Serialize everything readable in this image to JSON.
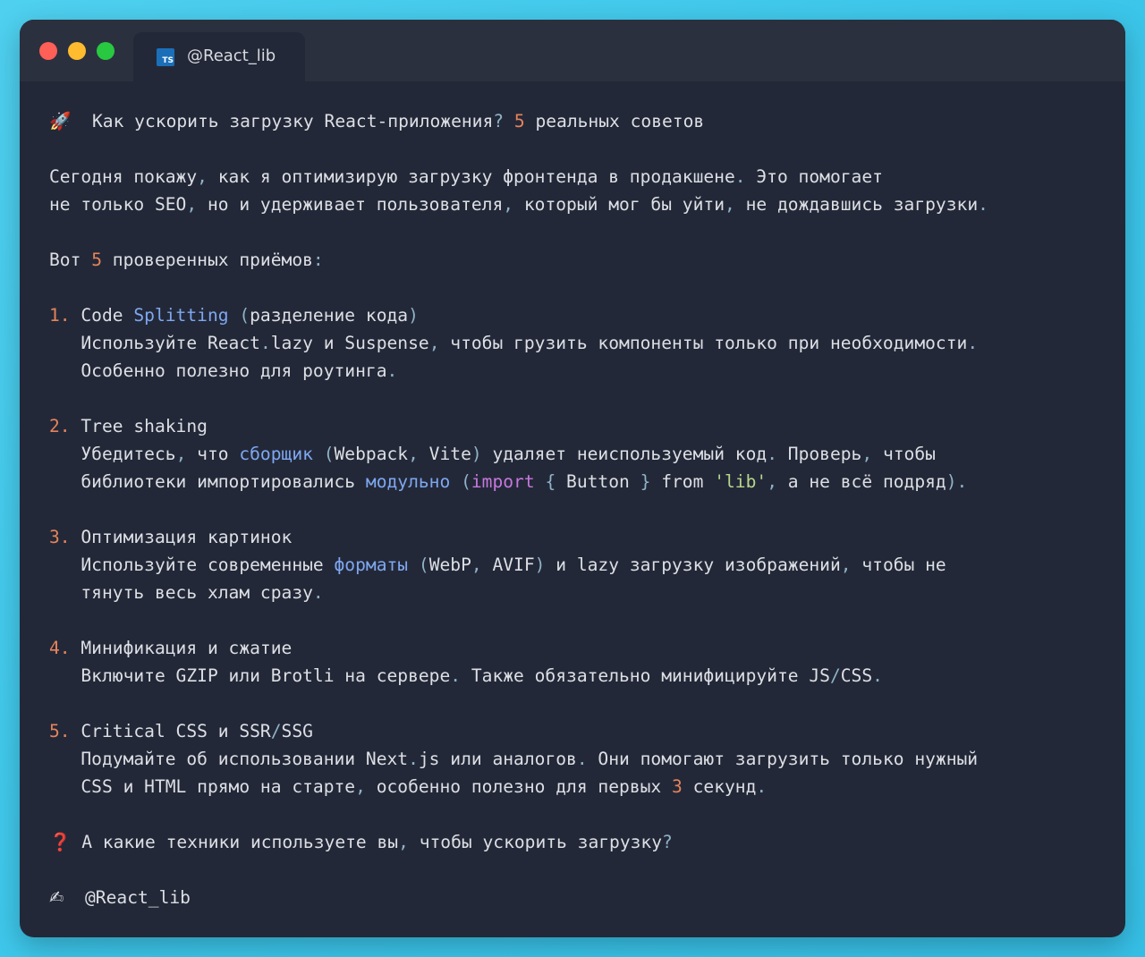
{
  "window": {
    "tab_title": "@React_lib",
    "tab_icon": "typescript-file-icon",
    "tab_icon_text": "TS"
  },
  "colors": {
    "text": "#dcdfe4",
    "number": "#e5845a",
    "keyword_blue": "#7ea8f0",
    "keyword_purple": "#c678dd",
    "string_green": "#b7d68a",
    "punctuation": "#8fb3c7",
    "question_red": "#f0454a"
  },
  "lines": [
    {
      "tokens": [
        {
          "t": "🚀",
          "c": "emoji"
        },
        {
          "t": "  Как ускорить загрузку React-приложения"
        },
        {
          "t": "?",
          "c": "hl-punct"
        },
        {
          "t": " "
        },
        {
          "t": "5",
          "c": "hl-orange"
        },
        {
          "t": " реальных советов"
        }
      ]
    },
    {
      "gap": true
    },
    {
      "tokens": [
        {
          "t": "Сегодня покажу"
        },
        {
          "t": ",",
          "c": "hl-punct"
        },
        {
          "t": " как я оптимизирую загрузку фронтенда в продакшене"
        },
        {
          "t": ".",
          "c": "hl-punct"
        },
        {
          "t": " Это помогает"
        }
      ]
    },
    {
      "tokens": [
        {
          "t": "не только SEO"
        },
        {
          "t": ",",
          "c": "hl-punct"
        },
        {
          "t": " но и удерживает пользователя"
        },
        {
          "t": ",",
          "c": "hl-punct"
        },
        {
          "t": " который мог бы уйти"
        },
        {
          "t": ",",
          "c": "hl-punct"
        },
        {
          "t": " не дождавшись загрузки"
        },
        {
          "t": ".",
          "c": "hl-punct"
        }
      ]
    },
    {
      "gap": true
    },
    {
      "tokens": [
        {
          "t": "Вот "
        },
        {
          "t": "5",
          "c": "hl-orange"
        },
        {
          "t": " проверенных приёмов"
        },
        {
          "t": ":",
          "c": "hl-punct"
        }
      ]
    },
    {
      "gap": true
    },
    {
      "tokens": [
        {
          "t": "1.",
          "c": "hl-orange"
        },
        {
          "t": " Code "
        },
        {
          "t": "Splitting",
          "c": "hl-blue"
        },
        {
          "t": " "
        },
        {
          "t": "(",
          "c": "hl-punct"
        },
        {
          "t": "разделение кода"
        },
        {
          "t": ")",
          "c": "hl-punct"
        }
      ]
    },
    {
      "tokens": [
        {
          "t": "   Используйте React"
        },
        {
          "t": ".",
          "c": "hl-punct"
        },
        {
          "t": "lazy и Suspense"
        },
        {
          "t": ",",
          "c": "hl-punct"
        },
        {
          "t": " чтобы грузить компоненты только при необходимости"
        },
        {
          "t": ".",
          "c": "hl-punct"
        }
      ]
    },
    {
      "tokens": [
        {
          "t": "   Особенно полезно для роутинга"
        },
        {
          "t": ".",
          "c": "hl-punct"
        }
      ]
    },
    {
      "gap": true
    },
    {
      "tokens": [
        {
          "t": "2.",
          "c": "hl-orange"
        },
        {
          "t": " Tree shaking"
        }
      ]
    },
    {
      "tokens": [
        {
          "t": "   Убедитесь"
        },
        {
          "t": ",",
          "c": "hl-punct"
        },
        {
          "t": " что "
        },
        {
          "t": "сборщик",
          "c": "hl-blue"
        },
        {
          "t": " "
        },
        {
          "t": "(",
          "c": "hl-punct"
        },
        {
          "t": "Webpack"
        },
        {
          "t": ",",
          "c": "hl-punct"
        },
        {
          "t": " Vite"
        },
        {
          "t": ")",
          "c": "hl-punct"
        },
        {
          "t": " удаляет неиспользуемый код"
        },
        {
          "t": ".",
          "c": "hl-punct"
        },
        {
          "t": " Проверь"
        },
        {
          "t": ",",
          "c": "hl-punct"
        },
        {
          "t": " чтобы"
        }
      ]
    },
    {
      "tokens": [
        {
          "t": "   библиотеки импортировались "
        },
        {
          "t": "модульно",
          "c": "hl-blue"
        },
        {
          "t": " "
        },
        {
          "t": "(",
          "c": "hl-punct"
        },
        {
          "t": "import",
          "c": "hl-purple"
        },
        {
          "t": " "
        },
        {
          "t": "{",
          "c": "hl-punct"
        },
        {
          "t": " Button "
        },
        {
          "t": "}",
          "c": "hl-punct"
        },
        {
          "t": " from "
        },
        {
          "t": "'lib'",
          "c": "hl-green"
        },
        {
          "t": ",",
          "c": "hl-punct"
        },
        {
          "t": " а не всё подряд"
        },
        {
          "t": ").",
          "c": "hl-punct"
        }
      ]
    },
    {
      "gap": true
    },
    {
      "tokens": [
        {
          "t": "3.",
          "c": "hl-orange"
        },
        {
          "t": " Оптимизация картинок"
        }
      ]
    },
    {
      "tokens": [
        {
          "t": "   Используйте современные "
        },
        {
          "t": "форматы",
          "c": "hl-blue"
        },
        {
          "t": " "
        },
        {
          "t": "(",
          "c": "hl-punct"
        },
        {
          "t": "WebP"
        },
        {
          "t": ",",
          "c": "hl-punct"
        },
        {
          "t": " AVIF"
        },
        {
          "t": ")",
          "c": "hl-punct"
        },
        {
          "t": " и lazy загрузку изображений"
        },
        {
          "t": ",",
          "c": "hl-punct"
        },
        {
          "t": " чтобы не"
        }
      ]
    },
    {
      "tokens": [
        {
          "t": "   тянуть весь хлам сразу"
        },
        {
          "t": ".",
          "c": "hl-punct"
        }
      ]
    },
    {
      "gap": true
    },
    {
      "tokens": [
        {
          "t": "4.",
          "c": "hl-orange"
        },
        {
          "t": " Минификация и сжатие"
        }
      ]
    },
    {
      "tokens": [
        {
          "t": "   Включите GZIP или Brotli на сервере"
        },
        {
          "t": ".",
          "c": "hl-punct"
        },
        {
          "t": " Также обязательно минифицируйте JS"
        },
        {
          "t": "/",
          "c": "hl-punct"
        },
        {
          "t": "CSS"
        },
        {
          "t": ".",
          "c": "hl-punct"
        }
      ]
    },
    {
      "gap": true
    },
    {
      "tokens": [
        {
          "t": "5.",
          "c": "hl-orange"
        },
        {
          "t": " Critical CSS и SSR"
        },
        {
          "t": "/",
          "c": "hl-punct"
        },
        {
          "t": "SSG"
        }
      ]
    },
    {
      "tokens": [
        {
          "t": "   Подумайте об использовании Next"
        },
        {
          "t": ".",
          "c": "hl-punct"
        },
        {
          "t": "js или аналогов"
        },
        {
          "t": ".",
          "c": "hl-punct"
        },
        {
          "t": " Они помогают загрузить только нужный"
        }
      ]
    },
    {
      "tokens": [
        {
          "t": "   CSS и HTML прямо на старте"
        },
        {
          "t": ",",
          "c": "hl-punct"
        },
        {
          "t": " особенно полезно для первых "
        },
        {
          "t": "3",
          "c": "hl-orange"
        },
        {
          "t": " секунд"
        },
        {
          "t": ".",
          "c": "hl-punct"
        }
      ]
    },
    {
      "gap": true
    },
    {
      "tokens": [
        {
          "t": "❓",
          "c": "hl-red"
        },
        {
          "t": " А какие техники используете вы"
        },
        {
          "t": ",",
          "c": "hl-punct"
        },
        {
          "t": " чтобы ускорить загрузку"
        },
        {
          "t": "?",
          "c": "hl-punct"
        }
      ]
    },
    {
      "gap": true
    },
    {
      "tokens": [
        {
          "t": "✍",
          "c": "emoji"
        },
        {
          "t": "  @React_lib"
        }
      ]
    }
  ]
}
